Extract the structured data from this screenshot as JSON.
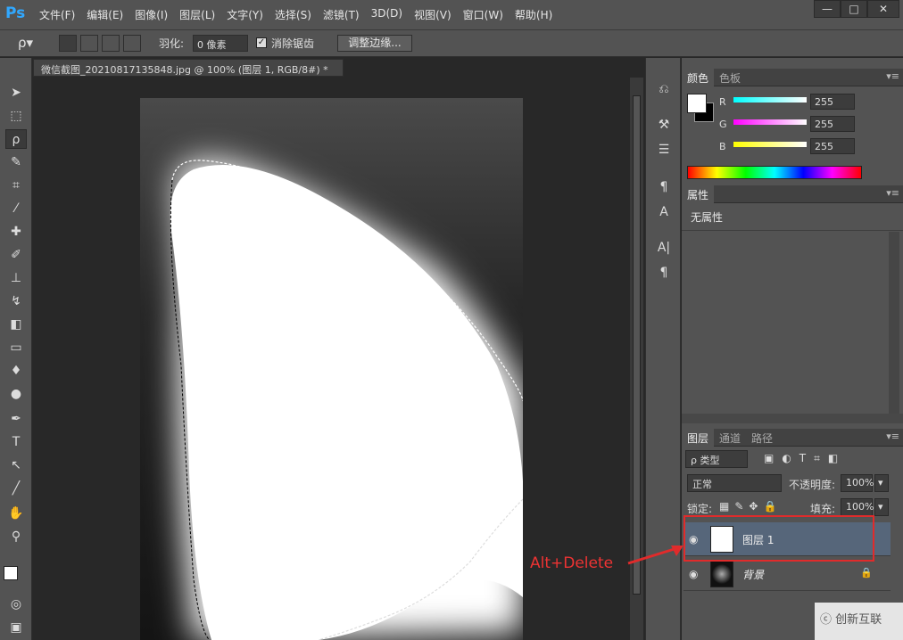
{
  "app": {
    "logo": "Ps"
  },
  "menu": [
    "文件(F)",
    "编辑(E)",
    "图像(I)",
    "图层(L)",
    "文字(Y)",
    "选择(S)",
    "滤镜(T)",
    "3D(D)",
    "视图(V)",
    "窗口(W)",
    "帮助(H)"
  ],
  "window_buttons": {
    "minimize": "—",
    "maximize": "□",
    "close": "✕"
  },
  "options": {
    "feather_label": "羽化:",
    "feather_value": "0 像素",
    "antialias_label": "消除锯齿",
    "refine_edge": "调整边缘..."
  },
  "document": {
    "tab_title": "微信截图_20210817135848.jpg @ 100% (图层 1, RGB/8#) *"
  },
  "color_panel": {
    "tabs": [
      "颜色",
      "色板"
    ],
    "sliders": [
      {
        "label": "R",
        "value": "255",
        "color": "#00ffff"
      },
      {
        "label": "G",
        "value": "255",
        "color": "#ff00ff"
      },
      {
        "label": "B",
        "value": "255",
        "color": "#ffff00"
      }
    ]
  },
  "properties_panel": {
    "tabs": [
      "属性"
    ],
    "body": "无属性"
  },
  "layers_panel": {
    "tabs": [
      "图层",
      "通道",
      "路径"
    ],
    "filter_kind": "ρ 类型",
    "blend_mode": "正常",
    "opacity_label": "不透明度:",
    "opacity_value": "100%",
    "lock_label": "锁定:",
    "fill_label": "填充:",
    "fill_value": "100%",
    "layers": [
      {
        "name": "图层 1",
        "selected": true
      },
      {
        "name": "背景",
        "selected": false
      }
    ]
  },
  "annotation": {
    "text": "Alt+Delete",
    "color": "#e12b2b"
  },
  "watermark": {
    "text": "创新互联"
  }
}
